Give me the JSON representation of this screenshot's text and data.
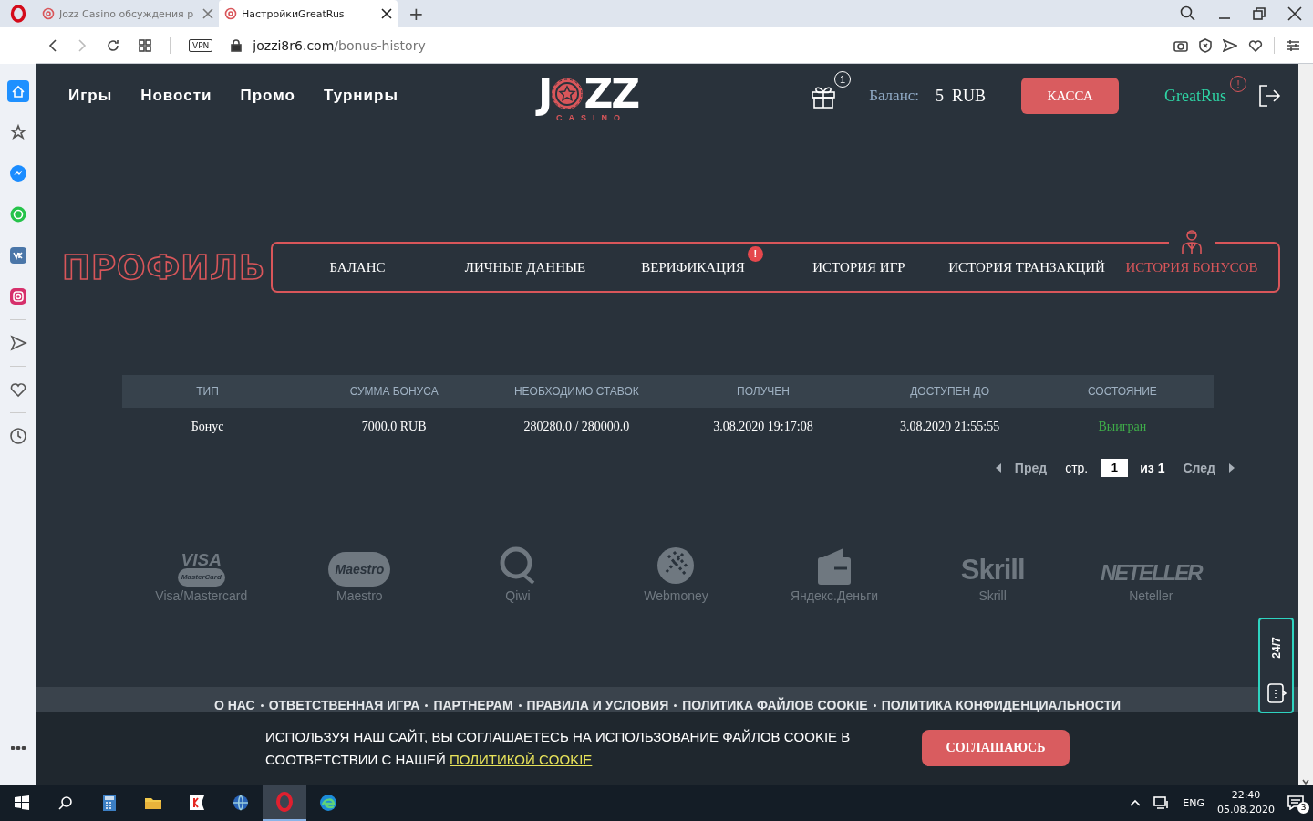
{
  "browser": {
    "tabs": [
      {
        "title": "Jozz Casino обсуждения р",
        "selected": false
      },
      {
        "title": "НастройкиGreatRus",
        "selected": true
      }
    ],
    "new_tab": "+",
    "vpn": "VPN",
    "url_domain": "jozzi8r6.com",
    "url_path": "/bonus-history"
  },
  "sidebar": {
    "items": [
      {
        "kind": "home",
        "selected": true
      },
      {
        "kind": "star",
        "selected": false
      },
      {
        "kind": "messenger",
        "selected": false
      },
      {
        "kind": "whatsapp",
        "selected": false
      },
      {
        "kind": "vk",
        "selected": false
      },
      {
        "kind": "instagram",
        "selected": false
      },
      {
        "kind": "send",
        "selected": false
      },
      {
        "kind": "heart",
        "selected": false
      },
      {
        "kind": "history",
        "selected": false
      }
    ]
  },
  "site_header": {
    "nav": [
      "Игры",
      "Новости",
      "Промо",
      "Турниры"
    ],
    "logo": {
      "lead": "J",
      "tail": "ZZ",
      "subtitle": "CASINO"
    },
    "gift_count": "1",
    "balance_label": "Баланс:",
    "balance_value": "5  RUB",
    "cashier_button": "КАССА",
    "username": "GreatRus",
    "user_alert": "!"
  },
  "profile": {
    "title": "ПРОФИЛЬ",
    "tabs": [
      {
        "label": "БАЛАНС",
        "selected": false
      },
      {
        "label": "ЛИЧНЫЕ ДАННЫЕ",
        "selected": false
      },
      {
        "label": "ВЕРИФИКАЦИЯ",
        "selected": false,
        "badge": "!"
      },
      {
        "label": "ИСТОРИЯ ИГР",
        "selected": false
      },
      {
        "label": "ИСТОРИЯ ТРАНЗАКЦИЙ",
        "selected": false
      },
      {
        "label": "ИСТОРИЯ БОНУСОВ",
        "selected": true
      }
    ]
  },
  "bonus_table": {
    "columns": [
      "ТИП",
      "СУММА БОНУСА",
      "НЕОБХОДИМО СТАВОК",
      "ПОЛУЧЕН",
      "ДОСТУПЕН ДО",
      "СОСТОЯНИЕ"
    ],
    "rows": [
      {
        "cells": [
          "Бонус",
          "7000.0 RUB",
          "280280.0 / 280000.0",
          "3.08.2020 19:17:08",
          "3.08.2020 21:55:55",
          "Выигран"
        ]
      }
    ]
  },
  "pagination": {
    "prev": "Пред",
    "page_label": "стр.",
    "page": "1",
    "of": "из 1",
    "next": "След"
  },
  "payment_methods": [
    {
      "kind": "visa",
      "name": "Visa/Mastercard",
      "logo": "VISA",
      "sublogo": "MasterCard"
    },
    {
      "kind": "maestro",
      "name": "Maestro",
      "logo": "Maestro"
    },
    {
      "kind": "qiwi",
      "name": "Qiwi"
    },
    {
      "kind": "webmoney",
      "name": "Webmoney"
    },
    {
      "kind": "yandex",
      "name": "Яндекс.Деньги"
    },
    {
      "kind": "skrill",
      "name": "Skrill",
      "logo": "Skrill"
    },
    {
      "kind": "neteller",
      "name": "Neteller",
      "logo": "NETELLER"
    }
  ],
  "footer_links": [
    "О НАС",
    "ОТВЕТСТВЕННАЯ ИГРА",
    "ПАРТНЕРАМ",
    "ПРАВИЛА И УСЛОВИЯ",
    "ПОЛИТИКА ФАЙЛОВ COOKIE",
    "ПОЛИТИКА КОНФИДЕНЦИАЛЬНОСТИ"
  ],
  "support_widget": {
    "label": "24/7"
  },
  "cookie_bar": {
    "text": "ИСПОЛЬЗУЯ НАШ САЙТ, ВЫ СОГЛАШАЕТЕСЬ НА ИСПОЛЬЗОВАНИЕ ФАЙЛОВ COOKIE В СООТВЕТСТВИИ С НАШЕЙ ",
    "link": "ПОЛИТИКОЙ COOKIE",
    "button": "СОГЛАШАЮСЬ"
  },
  "taskbar": {
    "language": "ENG",
    "time": "22:40",
    "date": "05.08.2020",
    "notifications": "3"
  }
}
